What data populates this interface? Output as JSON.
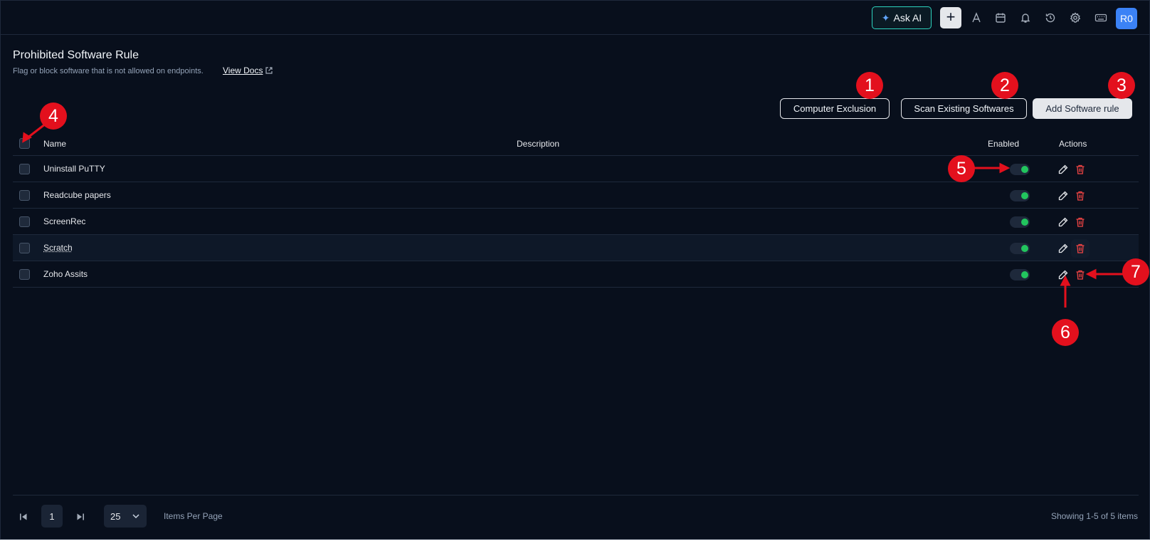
{
  "topbar": {
    "ask_ai_label": "Ask AI",
    "plus_label": "+",
    "avatar_initials": "R0",
    "icons": [
      "font-icon",
      "calendar-icon",
      "bell-icon",
      "history-icon",
      "gear-icon",
      "keyboard-icon"
    ]
  },
  "header": {
    "title": "Prohibited Software Rule",
    "subtitle": "Flag or block software that is not allowed on endpoints.",
    "docs_link": "View Docs"
  },
  "toolbar": {
    "computer_exclusion": "Computer Exclusion",
    "scan_existing": "Scan Existing Softwares",
    "add_rule": "Add Software rule"
  },
  "table": {
    "columns": {
      "name": "Name",
      "description": "Description",
      "enabled": "Enabled",
      "actions": "Actions"
    },
    "rows": [
      {
        "name": "Uninstall PuTTY",
        "description": "",
        "enabled": true
      },
      {
        "name": "Readcube papers",
        "description": "",
        "enabled": true
      },
      {
        "name": "ScreenRec",
        "description": "",
        "enabled": true
      },
      {
        "name": "Scratch",
        "description": "",
        "enabled": true
      },
      {
        "name": "Zoho Assits",
        "description": "",
        "enabled": true
      }
    ]
  },
  "pagination": {
    "current_page": "1",
    "per_page": "25",
    "per_page_label": "Items Per Page",
    "showing": "Showing 1-5 of 5 items"
  },
  "annotations": [
    "1",
    "2",
    "3",
    "4",
    "5",
    "6",
    "7"
  ],
  "colors": {
    "background": "#080f1c",
    "accent_toggle": "#22c55e",
    "delete": "#ef4444",
    "annotation": "#e3101d",
    "ask_ai_border": "#2dd4bf",
    "avatar": "#3b82f6"
  }
}
